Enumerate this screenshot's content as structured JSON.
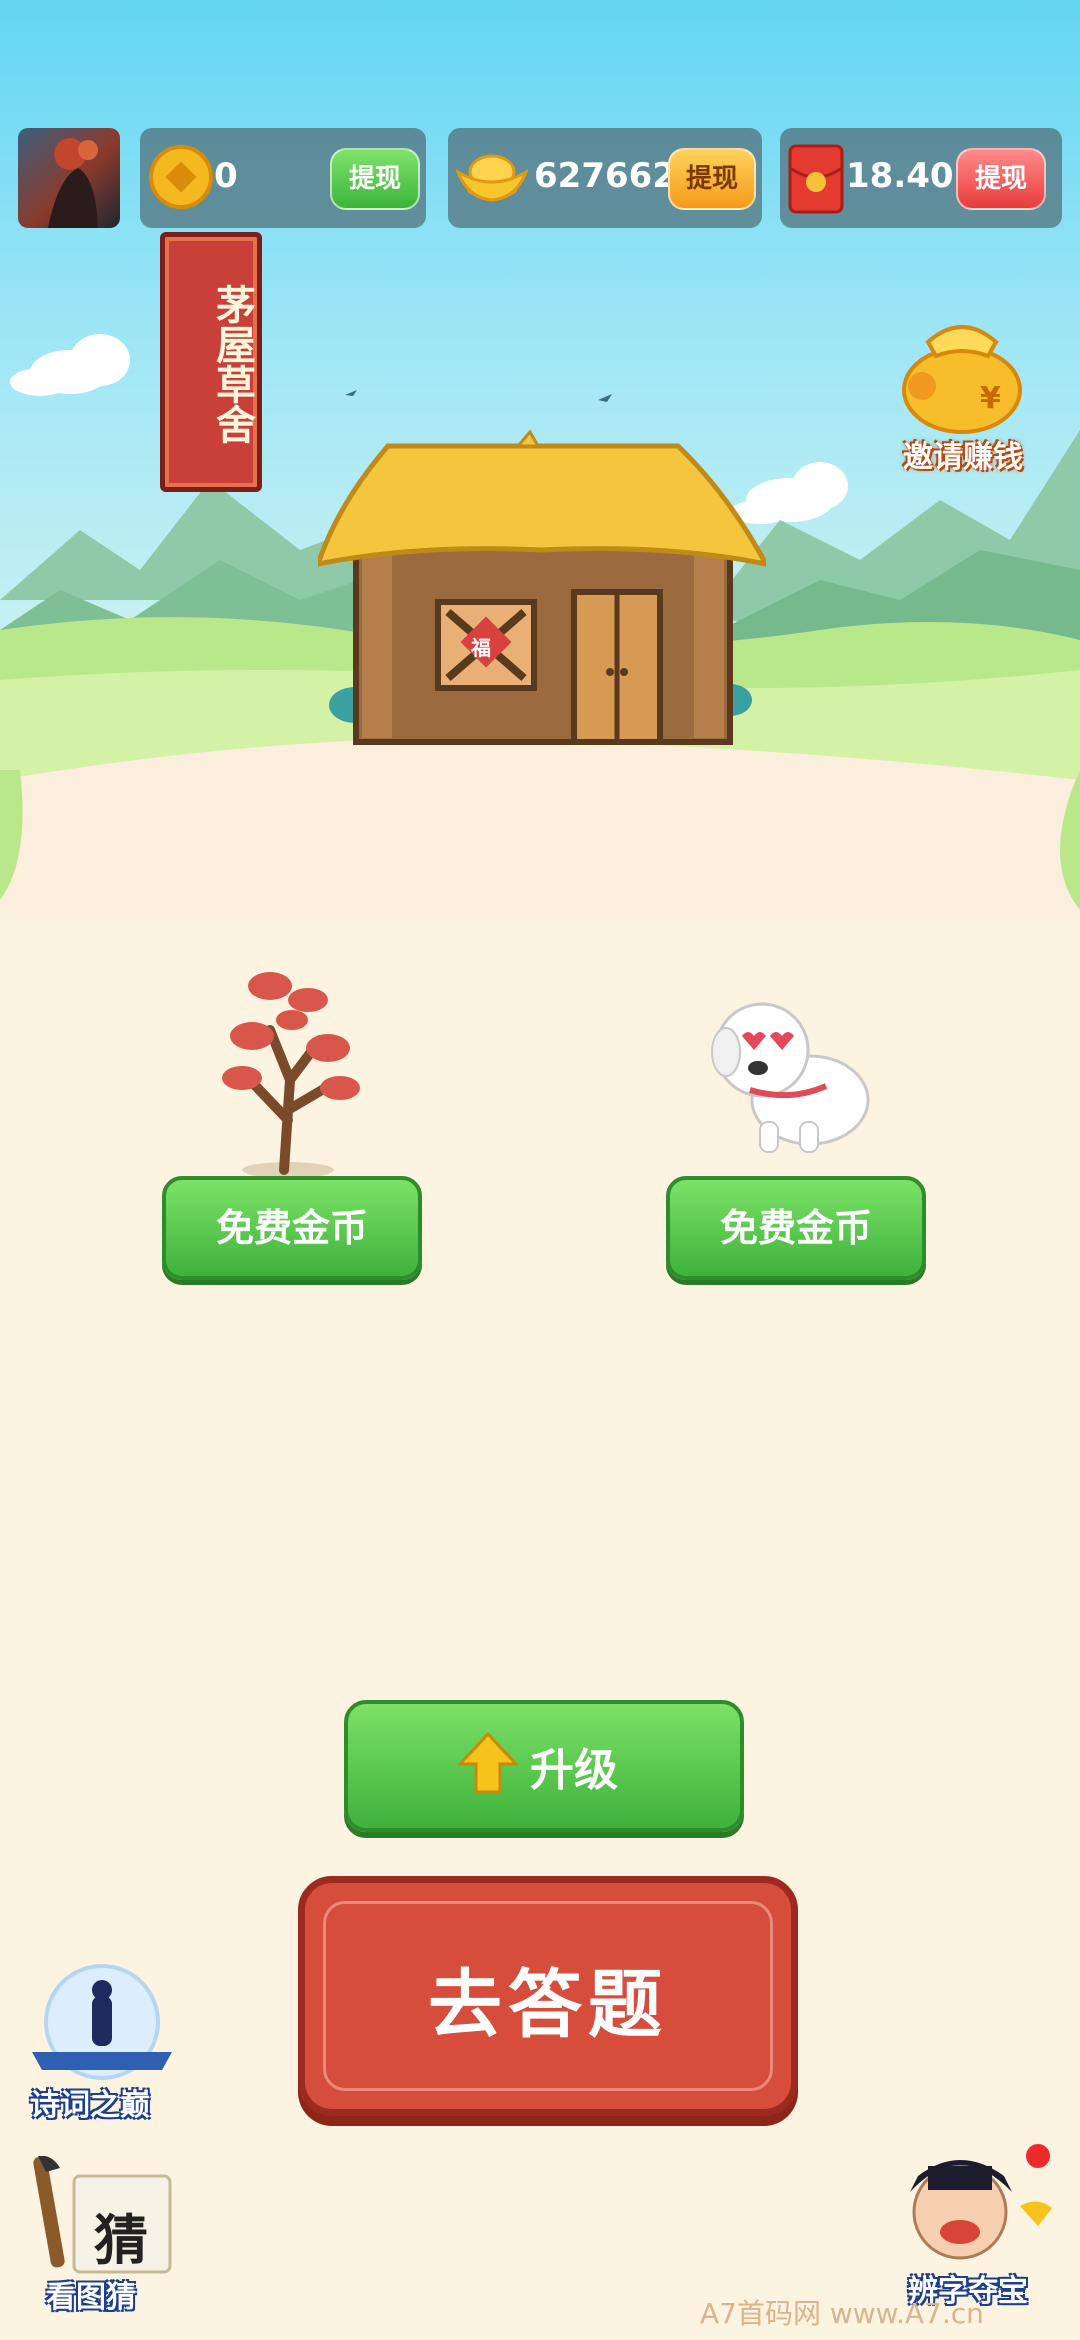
{
  "header": {
    "coins": {
      "value": "0",
      "withdraw_label": "提现",
      "icon": "copper-coin-icon"
    },
    "ingots": {
      "value": "627662",
      "withdraw_label": "提现",
      "icon": "gold-ingot-icon"
    },
    "redpacket": {
      "value": "18.40",
      "withdraw_label": "提现",
      "icon": "red-envelope-icon"
    }
  },
  "scene": {
    "banner_title": "茅屋草舍",
    "invite_label": "邀请赚钱",
    "house_sign": "福"
  },
  "rewards": {
    "tree_button": "免费金币",
    "dog_button": "免费金币"
  },
  "actions": {
    "upgrade_label": "升级",
    "answer_label": "去答题"
  },
  "side_games": {
    "poetry_label": "诗词之巅",
    "picture_guess_label": "看图猜",
    "picture_guess_char": "猜",
    "word_treasure_label": "辨字夺宝"
  },
  "watermark": "A7首码网   www.A7.cn",
  "colors": {
    "sky_top": "#63d6f3",
    "ground": "#fdf3e1",
    "green_button": "#3eb23c",
    "answer_red": "#d64d3c"
  }
}
